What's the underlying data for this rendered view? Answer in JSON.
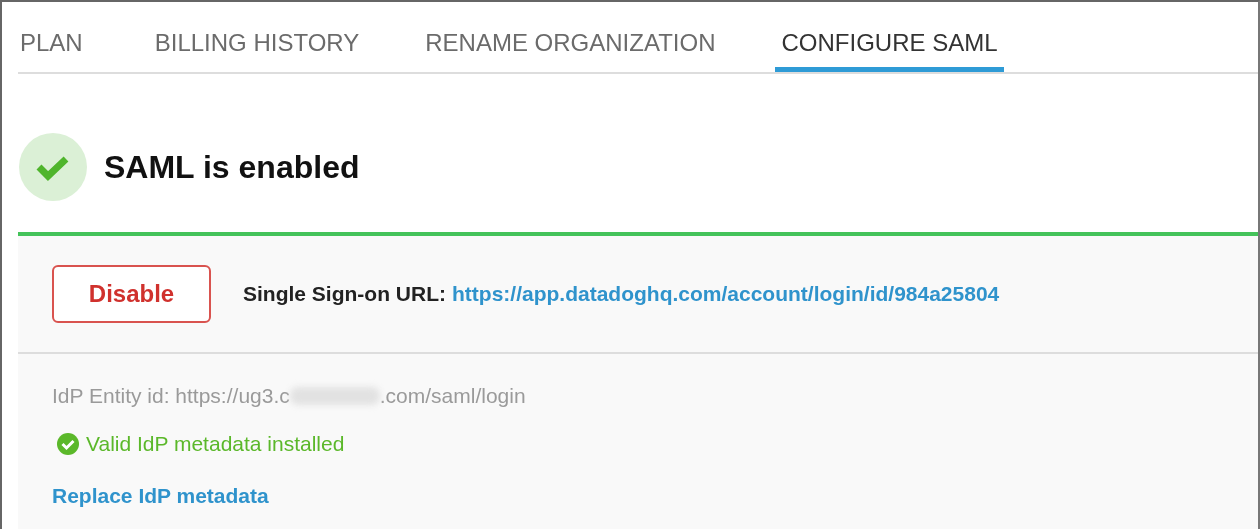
{
  "tabs": [
    {
      "label": "PLAN",
      "selected": false
    },
    {
      "label": "BILLING HISTORY",
      "selected": false
    },
    {
      "label": "RENAME ORGANIZATION",
      "selected": false
    },
    {
      "label": "CONFIGURE SAML",
      "selected": true
    }
  ],
  "status": {
    "title": "SAML is enabled",
    "enabled": true
  },
  "panel": {
    "disable_button": "Disable",
    "sso_label": "Single Sign-on URL:",
    "sso_url": "https://app.datadoghq.com/account/login/id/984a25804",
    "entity_id_before": "IdP Entity id: https://ug3.c",
    "entity_id_after": ".com/saml/login",
    "metadata_status": "Valid IdP metadata installed",
    "metadata_valid": true,
    "replace_link": "Replace IdP metadata"
  }
}
